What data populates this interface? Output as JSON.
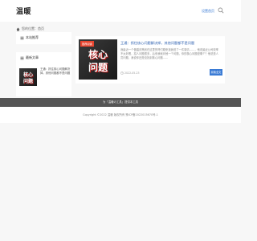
{
  "header": {
    "logo": "温暖",
    "favorite_link": "设置首页"
  },
  "breadcrumb": {
    "current": "您的位置：首页"
  },
  "sidebar": {
    "recommend_title": "本站推荐",
    "latest_title": "最新文章",
    "latest_item": {
      "title": "王通：抓住核心问题解决掉，其他问题都不是问题",
      "thumb_line1": "核心",
      "thumb_line2": "问题"
    }
  },
  "article": {
    "category": "推荐阅读",
    "title": "王通：抓住核心问题解决掉，其他问题都不是问题",
    "excerpt": "我最近一个做婚庆策划在这里的哥们刚来找我说了一件事情……，他说最近公司效率不太好看，招人问题很多，后来我就问他一个问题，你的核心问题是哪个？他说是人员问题，我说你还是没找到核心问题……",
    "date": "2022-05-23",
    "read_more": "阅读全文",
    "thumb_line1": "核心",
    "thumb_line2": "问题"
  },
  "footer": {
    "slogan": "为「温暖の工具」提供本工具",
    "copyright": "Copyright ©2022 温暖 版权所有 豫ICP备2022015670号-1"
  },
  "colors": {
    "accent": "#3a7bd5",
    "tag": "#e8452f",
    "footer_dark": "#555555"
  }
}
